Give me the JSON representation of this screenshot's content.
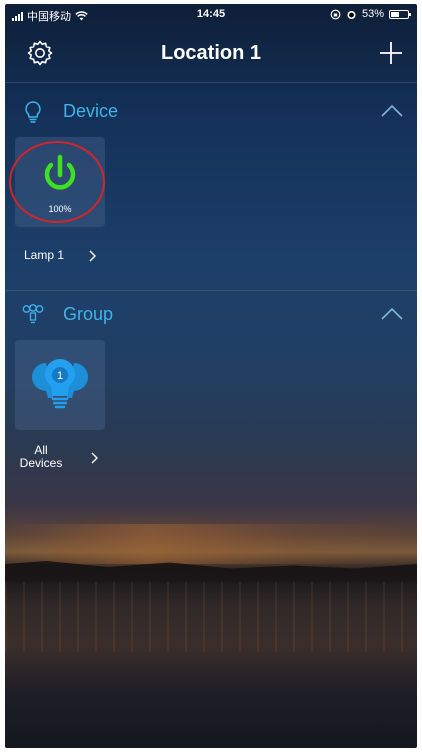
{
  "status_bar": {
    "carrier": "中国移动",
    "time": "14:45",
    "battery_percent": "53%",
    "battery_level": 0.53
  },
  "nav": {
    "title": "Location 1"
  },
  "device_section": {
    "title": "Device",
    "items": [
      {
        "label": "Lamp 1",
        "brightness": "100%",
        "power_icon": "power-icon",
        "on": true
      }
    ]
  },
  "group_section": {
    "title": "Group",
    "items": [
      {
        "label_line1": "All",
        "label_line2": "Devices",
        "count": "1"
      }
    ]
  },
  "colors": {
    "accent": "#3fb3ea",
    "power_on": "#3ee11f",
    "highlight_ring": "#d0252a",
    "bulb": "#22a0ef"
  },
  "icons": {
    "settings": "gear-icon",
    "add": "plus-icon",
    "device_section": "lightbulb-outline-icon",
    "group_section": "group-bulbs-icon",
    "collapse": "chevron-up-icon",
    "item_arrow": "chevron-right-icon"
  }
}
